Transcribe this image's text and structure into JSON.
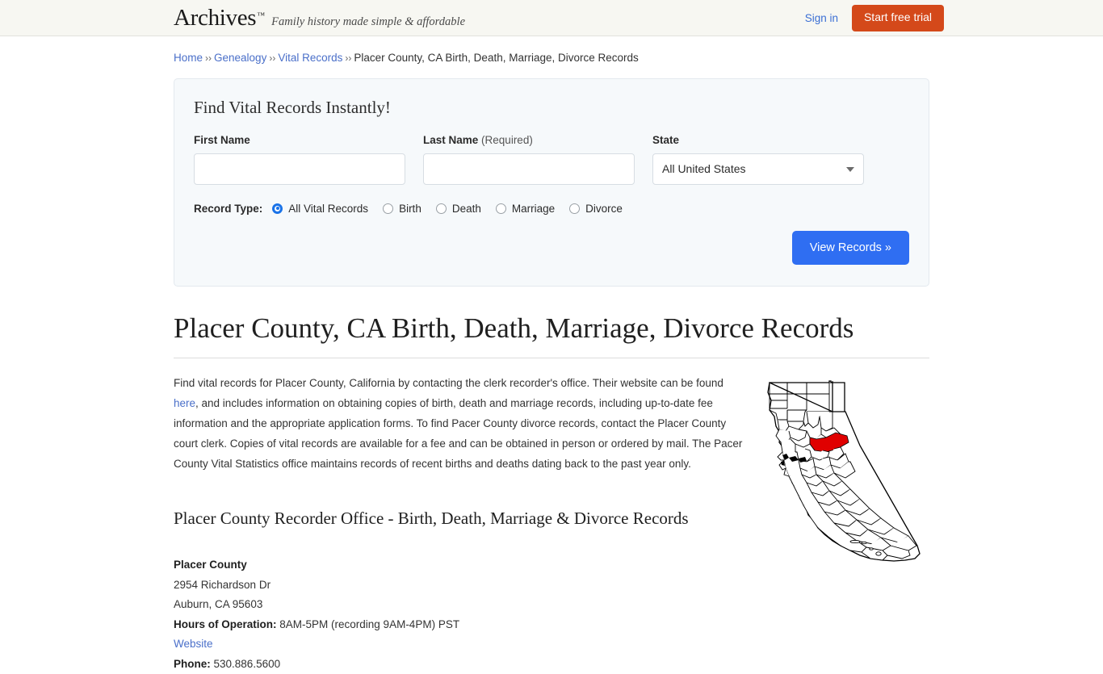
{
  "header": {
    "logo": "Archives",
    "logo_tm": "™",
    "tagline": "Family history made simple & affordable",
    "sign_in": "Sign in",
    "start_trial": "Start free trial",
    "trial_color": "#d4491a",
    "link_color": "#3b6fd4"
  },
  "breadcrumb": {
    "items": [
      {
        "label": "Home",
        "link": true
      },
      {
        "label": "Genealogy",
        "link": true
      },
      {
        "label": "Vital Records",
        "link": true
      },
      {
        "label": "Placer County, CA Birth, Death, Marriage, Divorce Records",
        "link": false
      }
    ],
    "separator": "››"
  },
  "search_panel": {
    "title": "Find Vital Records Instantly!",
    "first_name": {
      "label": "First Name",
      "value": "",
      "placeholder": ""
    },
    "last_name": {
      "label": "Last Name",
      "required_note": "(Required)",
      "value": "",
      "placeholder": ""
    },
    "state": {
      "label": "State",
      "selected": "All United States",
      "caret": "chevron-down-icon"
    },
    "record_type": {
      "label": "Record Type:",
      "options": [
        {
          "label": "All Vital Records",
          "checked": true
        },
        {
          "label": "Birth",
          "checked": false
        },
        {
          "label": "Death",
          "checked": false
        },
        {
          "label": "Marriage",
          "checked": false
        },
        {
          "label": "Divorce",
          "checked": false
        }
      ]
    },
    "submit_label": "View Records »",
    "submit_color": "#2f6ef2"
  },
  "main": {
    "title": "Placer County, CA Birth, Death, Marriage, Divorce Records",
    "paragraph_part1": "Find vital records for Placer County, California by contacting the clerk recorder's office. Their website can be found ",
    "paragraph_link": "here",
    "paragraph_part2": ", and includes information on obtaining copies of birth, death and marriage records, including up-to-date fee information and the appropriate application forms. To find Pacer County divorce records, contact the Placer County court clerk. Copies of vital records are available for a fee and can be obtained in person or ordered by mail. The Pacer County Vital Statistics office maintains records of recent births and deaths dating back to the past year only.",
    "subtitle": "Placer County Recorder Office - Birth, Death, Marriage & Divorce Records",
    "office": {
      "name": "Placer County",
      "street": "2954 Richardson Dr",
      "city_state_zip": "Auburn, CA 95603",
      "hours_label": "Hours of Operation:",
      "hours_value": "8AM-5PM (recording 9AM-4PM) PST",
      "website_link": "Website",
      "phone_label": "Phone:",
      "phone_value": "530.886.5600"
    },
    "map": {
      "alt": "California county map with Placer County highlighted",
      "highlight_color": "#e00000",
      "highlighted_county": "Placer"
    }
  }
}
